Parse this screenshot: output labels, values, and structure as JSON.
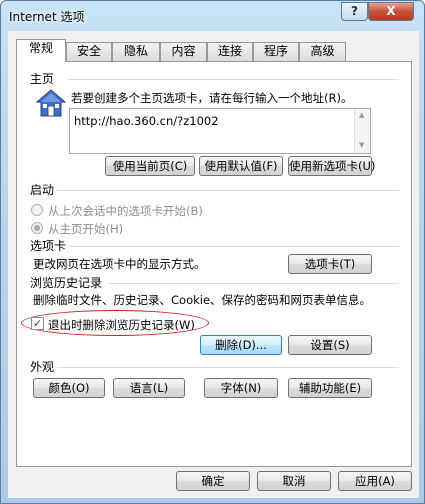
{
  "window": {
    "title": "Internet 选项",
    "help_label": "?",
    "close_label": "X"
  },
  "tabs": [
    "常规",
    "安全",
    "隐私",
    "内容",
    "连接",
    "程序",
    "高级"
  ],
  "home": {
    "section": "主页",
    "description": "若要创建多个主页选项卡，请在每行输入一个地址(R)。",
    "url": "http://hao.360.cn/?z1002",
    "btn_current": "使用当前页(C)",
    "btn_default": "使用默认值(F)",
    "btn_newtab": "使用新选项卡(U)"
  },
  "startup": {
    "section": "启动",
    "option_last": "从上次会话中的选项卡开始(B)",
    "option_home": "从主页开始(H)",
    "selected": "option_home"
  },
  "tabs_section": {
    "section": "选项卡",
    "description": "更改网页在选项卡中的显示方式。",
    "btn": "选项卡(T)"
  },
  "history": {
    "section": "浏览历史记录",
    "description": "删除临时文件、历史记录、Cookie、保存的密码和网页表单信息。",
    "checkbox_label": "退出时删除浏览历史记录(W)",
    "checkbox_checked": true,
    "btn_delete": "删除(D)...",
    "btn_settings": "设置(S)"
  },
  "appearance": {
    "section": "外观",
    "btn_colors": "颜色(O)",
    "btn_languages": "语言(L)",
    "btn_fonts": "字体(N)",
    "btn_accessibility": "辅助功能(E)"
  },
  "footer": {
    "ok": "确定",
    "cancel": "取消",
    "apply": "应用(A)"
  },
  "colors": {
    "highlight_oval": "#d42020",
    "house_blue": "#3e6fc4"
  }
}
